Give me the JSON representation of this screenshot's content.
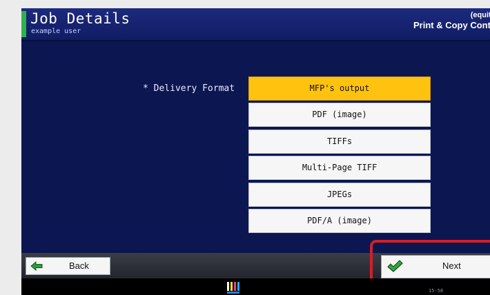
{
  "header": {
    "title": "Job Details",
    "user": "example user",
    "brand": "(equitr",
    "product": "Print & Copy Contr"
  },
  "form": {
    "field_label": "* Delivery Format",
    "options": [
      {
        "label": "MFP's output",
        "selected": true
      },
      {
        "label": "PDF (image)",
        "selected": false
      },
      {
        "label": "TIFFs",
        "selected": false
      },
      {
        "label": "Multi-Page TIFF",
        "selected": false
      },
      {
        "label": "JPEGs",
        "selected": false
      },
      {
        "label": "PDF/A (image)",
        "selected": false
      }
    ]
  },
  "nav": {
    "back_label": "Back",
    "back_icon": "arrow-left-icon",
    "next_label": "Next",
    "next_icon": "checkmark-icon"
  },
  "footer": {
    "status_code": "15-58",
    "toner_icon": "toner-level-icon"
  },
  "colors": {
    "panel_background": "#0c1650",
    "selected_option": "#ffc20e",
    "accent_green": "#2fb24a",
    "highlight_red": "#d0202a"
  }
}
